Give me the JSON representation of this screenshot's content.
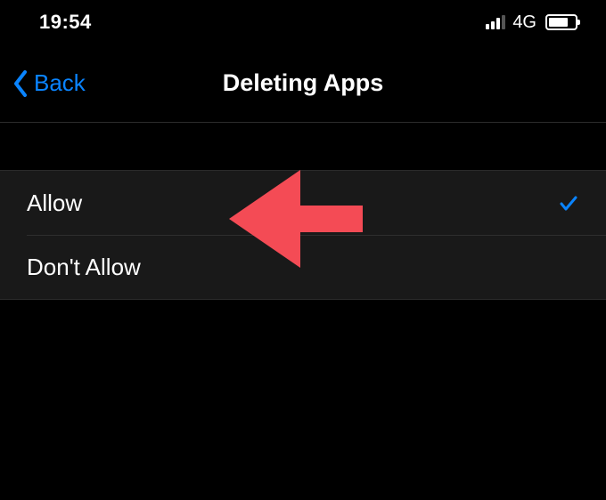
{
  "statusBar": {
    "time": "19:54",
    "network": "4G"
  },
  "nav": {
    "backLabel": "Back",
    "title": "Deleting Apps"
  },
  "options": {
    "allowLabel": "Allow",
    "dontAllowLabel": "Don't Allow",
    "selected": "allow"
  },
  "colors": {
    "link": "#0a84ff",
    "annotation": "#f44b55"
  }
}
